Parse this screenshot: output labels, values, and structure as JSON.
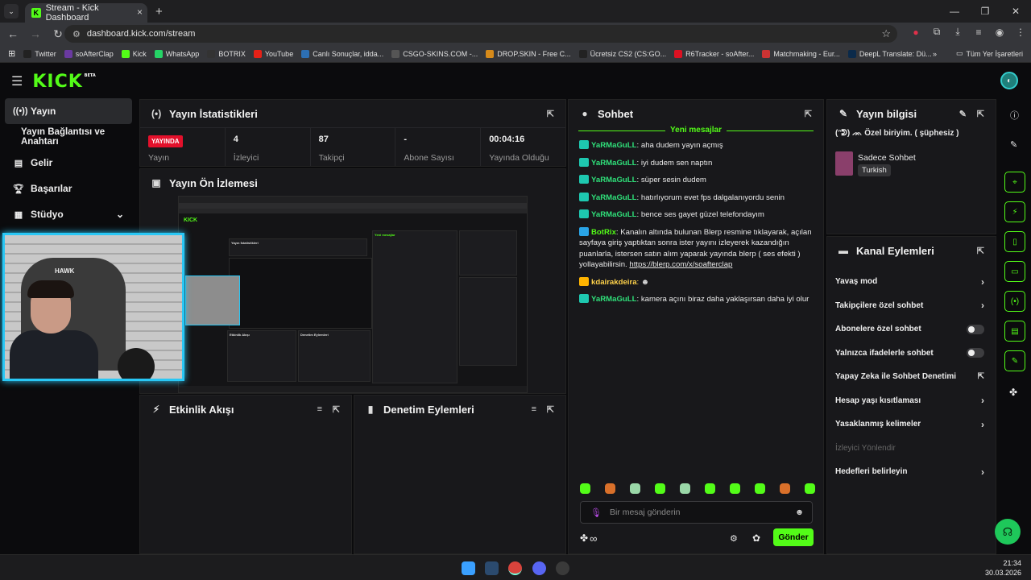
{
  "browser": {
    "tab_title": "Stream - Kick Dashboard",
    "url": "dashboard.kick.com/stream",
    "bookmarks": [
      "Twitter",
      "soAfterClap",
      "Kick",
      "WhatsApp",
      "BOTRIX",
      "YouTube",
      "Canlı Sonuçlar, idda...",
      "CSGO-SKINS.COM -...",
      "DROP.SKIN - Free C...",
      "Ücretsiz CS2 (CS:GO...",
      "R6Tracker - soAfter...",
      "Matchmaking - Eur...",
      "DeepL Translate: Dü..."
    ],
    "bookmarks_all": "Tüm Yer İşaretleri",
    "bookmarks_more": "»"
  },
  "app": {
    "logo": "KICK",
    "beta": "BETA"
  },
  "sidebar": {
    "items": [
      {
        "label": "Yayın",
        "icon": "broadcast-icon",
        "active": true
      },
      {
        "label": "Yayın Bağlantısı ve Anahtarı",
        "icon": "",
        "active": false
      },
      {
        "label": "Gelir",
        "icon": "revenue-icon",
        "active": false
      },
      {
        "label": "Başarılar",
        "icon": "trophy-icon",
        "active": false
      },
      {
        "label": "Stüdyo",
        "icon": "studio-icon",
        "active": false
      }
    ]
  },
  "cam": {
    "chair_brand": "HAWK"
  },
  "stats": {
    "title": "Yayın İstatistikleri",
    "live_badge": "YAYINDA",
    "live_label": "Yayın",
    "items": [
      {
        "value": "4",
        "label": "İzleyici"
      },
      {
        "value": "87",
        "label": "Takipçi"
      },
      {
        "value": "-",
        "label": "Abone Sayısı"
      },
      {
        "value": "00:04:16",
        "label": "Yayında Olduğu"
      }
    ]
  },
  "preview": {
    "title": "Yayın Ön İzlemesi"
  },
  "activity": {
    "title": "Etkinlik Akışı"
  },
  "moderation": {
    "title": "Denetim Eylemleri"
  },
  "chat": {
    "title": "Sohbet",
    "new_messages": "Yeni mesajlar",
    "messages": [
      {
        "user": "YaRMaGuLL",
        "text": "aha dudem yayın açmış",
        "type": "user"
      },
      {
        "user": "YaRMaGuLL",
        "text": "iyi dudem sen naptın",
        "type": "user"
      },
      {
        "user": "YaRMaGuLL",
        "text": "süper sesin dudem",
        "type": "user"
      },
      {
        "user": "YaRMaGuLL",
        "text": "hatırlıyorum evet fps dalgalanıyordu senin",
        "type": "user"
      },
      {
        "user": "YaRMaGuLL",
        "text": "bence ses gayet güzel telefondayım",
        "type": "user"
      },
      {
        "user": "BotRix",
        "text": "Kanalın altında bulunan Blerp resmine tıklayarak, açılan sayfaya giriş yaptıktan sonra ister yayını izleyerek kazandığın puanlarla, istersen satın alım yaparak yayında blerp ( ses efekti ) yollayabilirsin.",
        "link": "https://blerp.com/x/soafterclap",
        "type": "bot"
      },
      {
        "user": "kdairakdeira",
        "text": "",
        "type": "gold"
      },
      {
        "user": "YaRMaGuLL",
        "text": "kamera açını biraz daha yaklaşırsan daha iyi olur",
        "type": "user"
      }
    ],
    "input_placeholder": "Bir mesaj gönderin",
    "send_label": "Gönder",
    "infinity": "∞"
  },
  "info": {
    "title": "Yayın bilgisi",
    "stream_title": "(ᵔᕲ) ᨏ Özel biriyim. ( şüphesiz )",
    "category": "Sadece Sohbet",
    "tag": "Turkish"
  },
  "channel_actions": {
    "title": "Kanal Eylemleri",
    "items": [
      {
        "label": "Yavaş mod",
        "control": "chevron"
      },
      {
        "label": "Takipçilere özel sohbet",
        "control": "chevron"
      },
      {
        "label": "Abonelere özel sohbet",
        "control": "toggle"
      },
      {
        "label": "Yalnızca ifadelerle sohbet",
        "control": "toggle"
      },
      {
        "label": "Yapay Zeka ile Sohbet Denetimi",
        "control": "external"
      },
      {
        "label": "Hesap yaşı kısıtlaması",
        "control": "chevron"
      },
      {
        "label": "Yasaklanmış kelimeler",
        "control": "chevron"
      },
      {
        "label": "İzleyici Yönlendir",
        "control": "disabled"
      },
      {
        "label": "Hedefleri belirleyin",
        "control": "chevron"
      }
    ]
  },
  "taskbar": {
    "time": "21:34",
    "date": "30.03.2026"
  },
  "colors": {
    "accent": "#53fc18",
    "live": "#e3102b",
    "cam_border": "#29c7f5"
  }
}
